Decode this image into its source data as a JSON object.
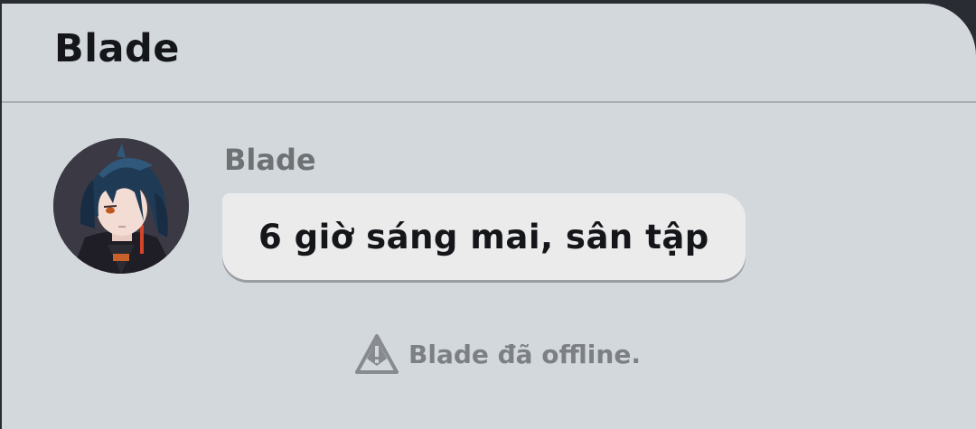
{
  "header": {
    "title": "Blade"
  },
  "message": {
    "sender": "Blade",
    "avatar_icon": "character-portrait",
    "text": "6 giờ sáng mai, sân tập"
  },
  "system_notice": {
    "icon": "warning-triangle-icon",
    "text": "Blade đã offline."
  },
  "colors": {
    "panel_bg": "#d3d8dc",
    "bubble_bg": "#ebebeb",
    "title_text": "#15161a",
    "muted_text": "#7c8084"
  }
}
